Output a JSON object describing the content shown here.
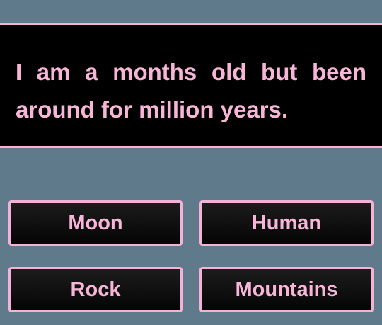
{
  "question": {
    "text": "I am a months old but been around for million years."
  },
  "answers": [
    {
      "label": "Moon"
    },
    {
      "label": "Human"
    },
    {
      "label": "Rock"
    },
    {
      "label": "Mountains"
    }
  ],
  "colors": {
    "background": "#5f7a8a",
    "panel": "#000000",
    "accent_pink": "#f4b3d6",
    "text_pink": "#f7b6d8"
  }
}
